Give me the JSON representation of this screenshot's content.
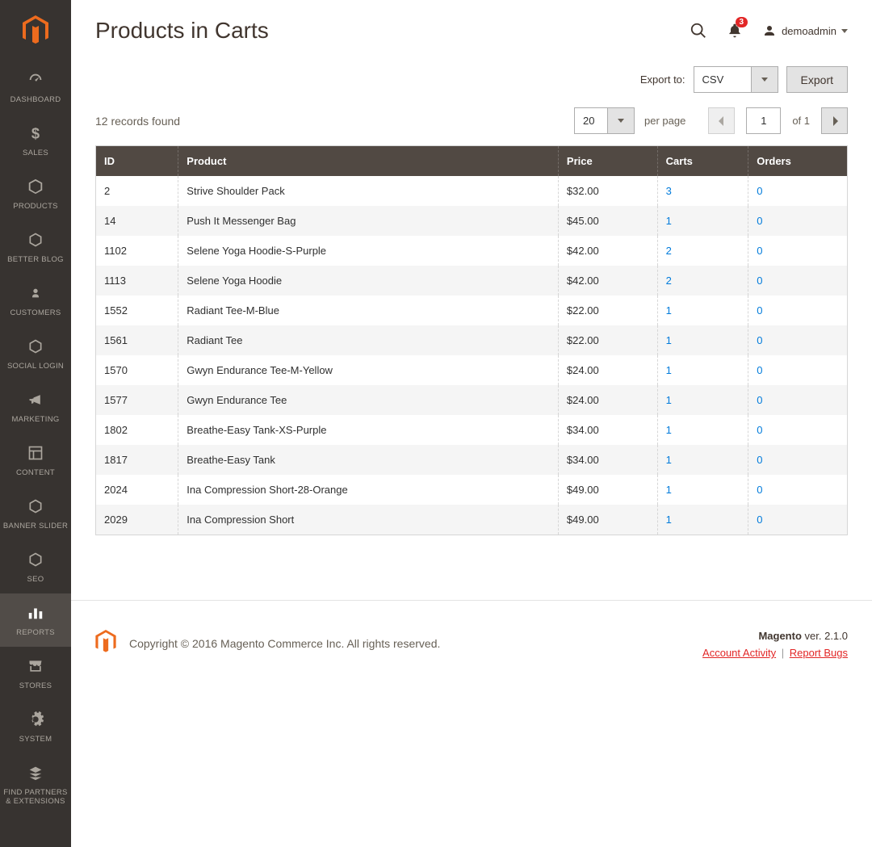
{
  "sidebar": {
    "items": [
      {
        "label": "DASHBOARD"
      },
      {
        "label": "SALES"
      },
      {
        "label": "PRODUCTS"
      },
      {
        "label": "BETTER BLOG"
      },
      {
        "label": "CUSTOMERS"
      },
      {
        "label": "SOCIAL LOGIN"
      },
      {
        "label": "MARKETING"
      },
      {
        "label": "CONTENT"
      },
      {
        "label": "BANNER SLIDER"
      },
      {
        "label": "SEO"
      },
      {
        "label": "REPORTS"
      },
      {
        "label": "STORES"
      },
      {
        "label": "SYSTEM"
      },
      {
        "label": "FIND PARTNERS\n& EXTENSIONS"
      }
    ]
  },
  "header": {
    "title": "Products in Carts",
    "notification_count": "3",
    "user": "demoadmin"
  },
  "export": {
    "label": "Export to:",
    "value": "CSV",
    "button": "Export"
  },
  "toolbar": {
    "records": "12 records found",
    "page_size": "20",
    "per_page_label": "per page",
    "current_page": "1",
    "of_label": "of 1"
  },
  "table": {
    "headers": [
      "ID",
      "Product",
      "Price",
      "Carts",
      "Orders"
    ],
    "rows": [
      {
        "id": "2",
        "product": "Strive Shoulder Pack",
        "price": "$32.00",
        "carts": "3",
        "orders": "0"
      },
      {
        "id": "14",
        "product": "Push It Messenger Bag",
        "price": "$45.00",
        "carts": "1",
        "orders": "0"
      },
      {
        "id": "1102",
        "product": "Selene Yoga Hoodie-S-Purple",
        "price": "$42.00",
        "carts": "2",
        "orders": "0"
      },
      {
        "id": "1113",
        "product": "Selene Yoga Hoodie",
        "price": "$42.00",
        "carts": "2",
        "orders": "0"
      },
      {
        "id": "1552",
        "product": "Radiant Tee-M-Blue",
        "price": "$22.00",
        "carts": "1",
        "orders": "0"
      },
      {
        "id": "1561",
        "product": "Radiant Tee",
        "price": "$22.00",
        "carts": "1",
        "orders": "0"
      },
      {
        "id": "1570",
        "product": "Gwyn Endurance Tee-M-Yellow",
        "price": "$24.00",
        "carts": "1",
        "orders": "0"
      },
      {
        "id": "1577",
        "product": "Gwyn Endurance Tee",
        "price": "$24.00",
        "carts": "1",
        "orders": "0"
      },
      {
        "id": "1802",
        "product": "Breathe-Easy Tank-XS-Purple",
        "price": "$34.00",
        "carts": "1",
        "orders": "0"
      },
      {
        "id": "1817",
        "product": "Breathe-Easy Tank",
        "price": "$34.00",
        "carts": "1",
        "orders": "0"
      },
      {
        "id": "2024",
        "product": "Ina Compression Short-28-Orange",
        "price": "$49.00",
        "carts": "1",
        "orders": "0"
      },
      {
        "id": "2029",
        "product": "Ina Compression Short",
        "price": "$49.00",
        "carts": "1",
        "orders": "0"
      }
    ]
  },
  "footer": {
    "copyright": "Copyright © 2016 Magento Commerce Inc. All rights reserved.",
    "brand": "Magento",
    "version": " ver. 2.1.0",
    "activity": "Account Activity",
    "bugs": "Report Bugs"
  }
}
